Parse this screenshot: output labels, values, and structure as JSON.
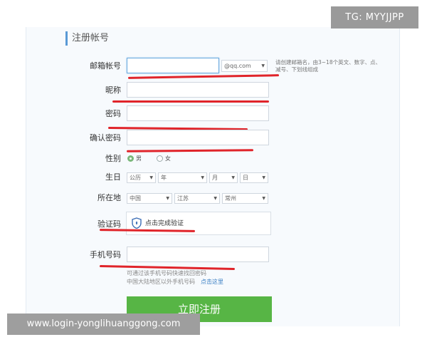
{
  "watermark_top": "TG: MYYJJPP",
  "watermark_bottom": "www.login-yonglihuanggong.com",
  "section_title": "注册帐号",
  "labels": {
    "email": "邮箱帐号",
    "nickname": "昵称",
    "password": "密码",
    "confirm_password": "确认密码",
    "gender": "性别",
    "birthday": "生日",
    "location": "所在地",
    "captcha": "验证码",
    "phone": "手机号码"
  },
  "email": {
    "value": "",
    "domain_selected": "@qq.com",
    "hint": "请创建邮箱名，由3~18个英文、数字、点、减号、下划线组成"
  },
  "gender": {
    "male": "男",
    "female": "女",
    "selected": "male"
  },
  "birthday": {
    "calendar": "公历",
    "year": "年",
    "month": "月",
    "day": "日"
  },
  "location": {
    "country": "中国",
    "province": "江苏",
    "city": "常州"
  },
  "captcha": {
    "button_text": "点击完成验证"
  },
  "phone": {
    "note_line1": "可通过该手机号码快速找回密码",
    "note_line2": "中国大陆地区以外手机号码",
    "note_link": "点击这里"
  },
  "submit_label": "立即注册",
  "colors": {
    "accent_blue": "#5a9ad6",
    "submit_green": "#57b545",
    "redaction_red": "#e0242a"
  }
}
